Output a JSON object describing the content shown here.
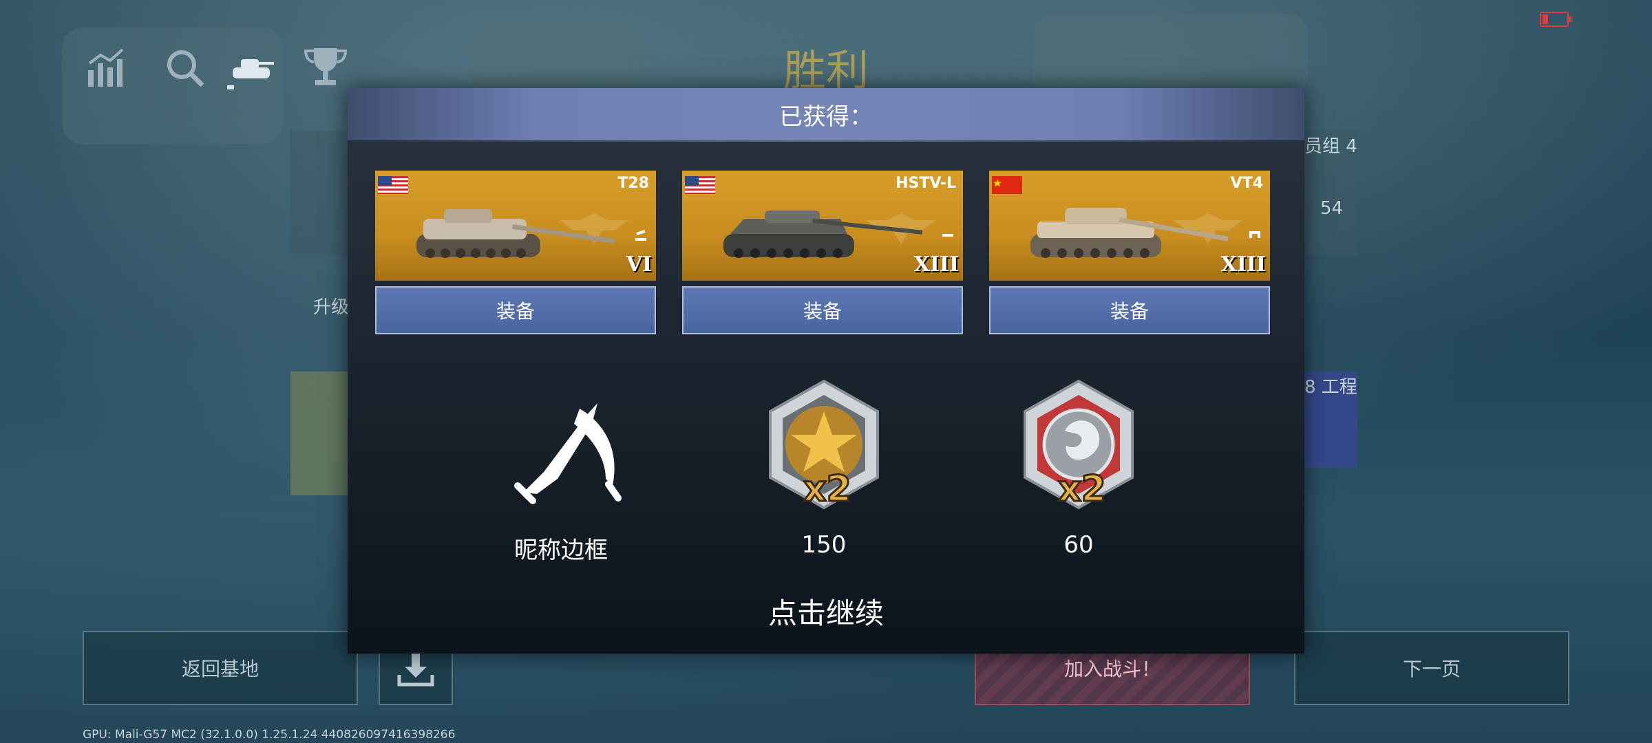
{
  "background": {
    "victory_title": "胜利",
    "side_right_top": "员组 4",
    "side_right_count": "54",
    "side_left_label": "升级",
    "side_right_bottom": "8 工程",
    "bottom_buttons": {
      "return_base": "返回基地",
      "join_battle": "加入战斗！",
      "next_page": "下一页"
    },
    "gpu_info": "GPU: Mali-G57 MC2 (32.1.0.0)  1.25.1.24  440826097416398266",
    "top_icons": [
      "stats-icon",
      "search-icon",
      "tank-icon",
      "trophy-icon"
    ]
  },
  "overlay": {
    "header": "已获得：",
    "vehicles": [
      {
        "name": "T28",
        "flag": "US",
        "tier": "VI",
        "rank": "2",
        "equip_label": "装备"
      },
      {
        "name": "HSTV-L",
        "flag": "US",
        "tier": "XIII",
        "rank": "1",
        "equip_label": "装备"
      },
      {
        "name": "VT4",
        "flag": "CN",
        "tier": "XIII",
        "rank": "1",
        "equip_label": "装备"
      }
    ],
    "rewards": [
      {
        "icon": "crossed-knives-icon",
        "label": "昵称边框"
      },
      {
        "icon": "gold-star-medal-icon",
        "multiplier": "x2",
        "label": "150"
      },
      {
        "icon": "silver-lion-medal-icon",
        "multiplier": "x2",
        "label": "60"
      }
    ],
    "continue_hint": "点击继续"
  },
  "colors": {
    "header_blue": "#7485b6",
    "card_gold": "#d89e28",
    "equip_blue": "#4a64a0",
    "victory_gold": "#c9b04c",
    "battery_red": "#e23b3b"
  }
}
